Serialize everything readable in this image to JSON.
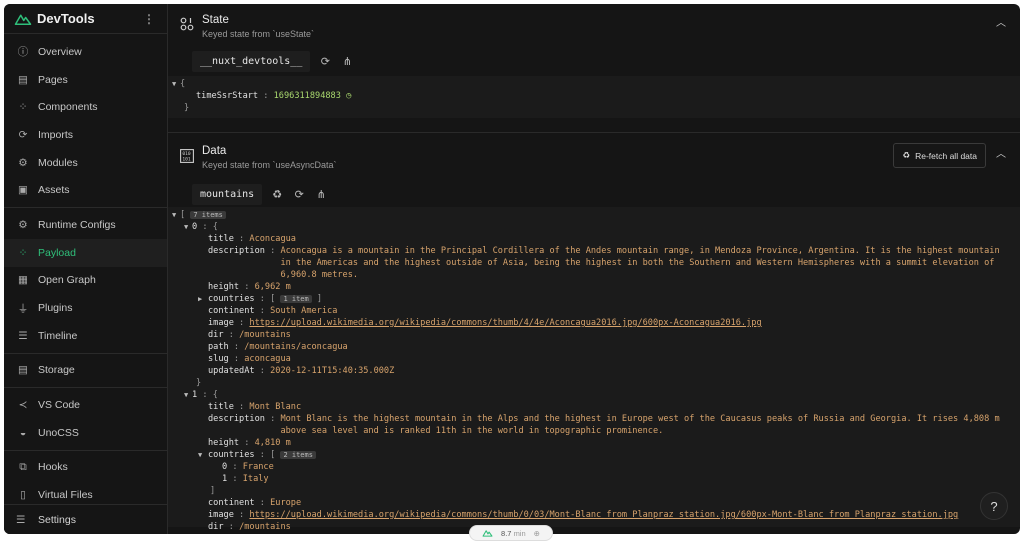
{
  "app": {
    "title": "DevTools"
  },
  "sidebar": {
    "items": [
      {
        "label": "Overview"
      },
      {
        "label": "Pages"
      },
      {
        "label": "Components"
      },
      {
        "label": "Imports"
      },
      {
        "label": "Modules"
      },
      {
        "label": "Assets"
      },
      {
        "label": "Runtime Configs"
      },
      {
        "label": "Payload"
      },
      {
        "label": "Open Graph"
      },
      {
        "label": "Plugins"
      },
      {
        "label": "Timeline"
      },
      {
        "label": "Storage"
      },
      {
        "label": "VS Code"
      },
      {
        "label": "UnoCSS"
      },
      {
        "label": "Hooks"
      },
      {
        "label": "Virtual Files"
      }
    ],
    "settings_label": "Settings"
  },
  "state": {
    "title": "State",
    "desc": "Keyed state from `useState`",
    "tab": "__nuxt_devtools__",
    "open_brace": "{",
    "key": "timeSsrStart",
    "value": "1696311894883",
    "close_brace": "}"
  },
  "data": {
    "title": "Data",
    "desc": "Keyed state from `useAsyncData`",
    "refetch_label": "Re-fetch all data",
    "tab": "mountains",
    "count_badge": "7 items",
    "m0": {
      "index": "0",
      "title": "Aconcagua",
      "description": "Aconcagua is a mountain in the Principal Cordillera of the Andes mountain range, in Mendoza Province, Argentina. It is the highest mountain in the Americas and the highest outside of Asia, being the highest in both the Southern and Western Hemispheres with a summit elevation of 6,960.8 metres.",
      "height": "6,962 m",
      "countries_badge": "1 item",
      "continent": "South America",
      "image": "https://upload.wikimedia.org/wikipedia/commons/thumb/4/4e/Aconcagua2016.jpg/600px-Aconcagua2016.jpg",
      "dir": "/mountains",
      "path": "/mountains/aconcagua",
      "slug": "aconcagua",
      "updatedAt": "2020-12-11T15:40:35.000Z"
    },
    "m1": {
      "index": "1",
      "title": "Mont Blanc",
      "description": "Mont Blanc is the highest mountain in the Alps and the highest in Europe west of the Caucasus peaks of Russia and Georgia. It rises 4,808 m above sea level and is ranked 11th in the world in topographic prominence.",
      "height": "4,810 m",
      "countries_badge": "2 items",
      "country0": "France",
      "country1": "Italy",
      "continent": "Europe",
      "image": "https://upload.wikimedia.org/wikipedia/commons/thumb/0/03/Mont-Blanc_from_Planpraz_station.jpg/600px-Mont-Blanc_from_Planpraz_station.jpg",
      "dir": "/mountains"
    }
  },
  "keys": {
    "title": "title",
    "description": "description",
    "height": "height",
    "countries": "countries",
    "continent": "continent",
    "image": "image",
    "dir": "dir",
    "path": "path",
    "slug": "slug",
    "updatedAt": "updatedAt"
  },
  "status_pill": {
    "time": "8.7",
    "unit": "min"
  },
  "help_label": "?",
  "colors": {
    "accent": "#2fbf7a",
    "background": "#151515"
  }
}
